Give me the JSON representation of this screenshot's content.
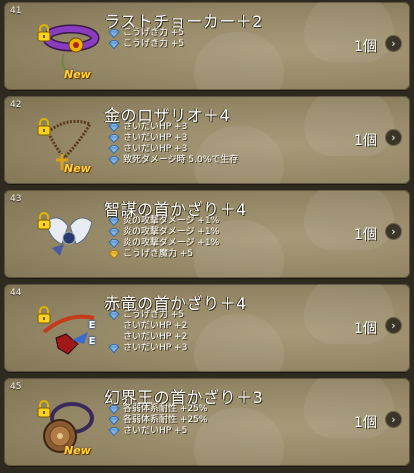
{
  "items": [
    {
      "number": "41",
      "name": "ラストチョーカー＋2",
      "new_badge": "New",
      "stats": [
        {
          "text": "こうげき力 +5",
          "gem": "blue"
        },
        {
          "text": "こうげき力 +5",
          "gem": "blue"
        }
      ],
      "count": "1個",
      "icon": "purple-choker-icon"
    },
    {
      "number": "42",
      "name": "金のロザリオ＋4",
      "new_badge": "New",
      "stats": [
        {
          "text": "さいだいHP +3",
          "gem": "blue"
        },
        {
          "text": "さいだいHP +3",
          "gem": "blue"
        },
        {
          "text": "さいだいHP +3",
          "gem": "blue"
        },
        {
          "text": "致死ダメージ時 5.0%で生存",
          "gem": "blue"
        }
      ],
      "count": "1個",
      "icon": "gold-rosary-icon"
    },
    {
      "number": "43",
      "name": "智謀の首かざり＋4",
      "stats": [
        {
          "text": "炎の攻撃ダメージ +1%",
          "gem": "blue"
        },
        {
          "text": "炎の攻撃ダメージ +1%",
          "gem": "blue"
        },
        {
          "text": "炎の攻撃ダメージ +1%",
          "gem": "blue"
        },
        {
          "text": "こうげき魔力 +5",
          "gem": "gold"
        }
      ],
      "count": "1個",
      "icon": "winged-necklace-icon"
    },
    {
      "number": "44",
      "name": "赤竜の首かざり＋4",
      "equipped_badge": "E",
      "stats": [
        {
          "text": "こうげき力 +5",
          "gem": "blue"
        },
        {
          "text": "さいだいHP +2",
          "gem": ""
        },
        {
          "text": "さいだいHP +2",
          "gem": ""
        },
        {
          "text": "さいだいHP +3",
          "gem": "blue"
        }
      ],
      "count": "1個",
      "icon": "red-dragon-necklace-icon"
    },
    {
      "number": "45",
      "name": "幻界王の首かざり＋3",
      "new_badge": "New",
      "stats": [
        {
          "text": "各弱体系耐性 +25%",
          "gem": "blue"
        },
        {
          "text": "各弱体系耐性 +25%",
          "gem": "blue"
        },
        {
          "text": "さいだいHP +5",
          "gem": "blue"
        }
      ],
      "count": "1個",
      "icon": "phantom-king-necklace-icon"
    }
  ]
}
